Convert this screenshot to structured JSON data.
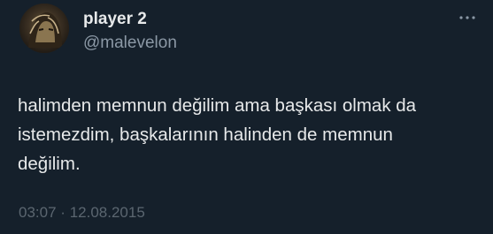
{
  "tweet": {
    "display_name": "player 2",
    "handle": "@malevelon",
    "more_icon": "more-horizontal-icon",
    "text": "halimden memnun değilim ama başkası olmak da\nistemezdim, başkalarının halinden de memnun\ndeğilim.",
    "time": "03:07",
    "separator": "·",
    "date": "12.08.2015"
  },
  "colors": {
    "background": "#15202b",
    "primary_text": "#e7e9ea",
    "secondary_text": "#8b98a5",
    "timestamp_text": "#5b6670"
  }
}
